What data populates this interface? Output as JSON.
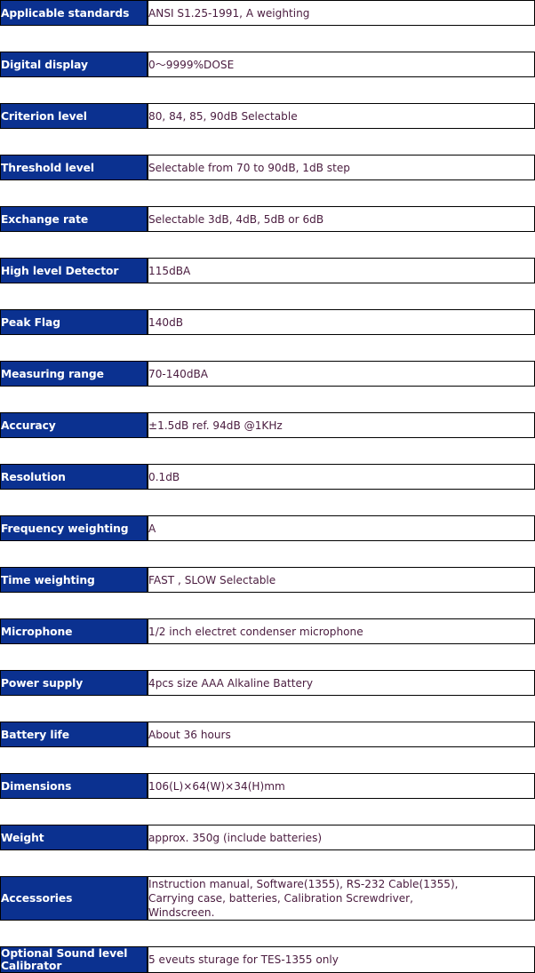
{
  "document": {
    "title": "Sound Level Meter Specifications",
    "colors": {
      "label_background": "#0b3190",
      "label_text": "#ffffff",
      "value_text": "#4a1c3f",
      "border": "#000000",
      "page_background": "#ffffff"
    }
  },
  "spec_table": {
    "rows": [
      {
        "label": "Applicable standards",
        "value": "ANSI S1.25-1991, A weighting"
      },
      {
        "label": "Digital display",
        "value": "0〜9999%DOSE"
      },
      {
        "label": "Criterion level",
        "value": "80, 84, 85, 90dB Selectable"
      },
      {
        "label": "Threshold level",
        "value": "Selectable from 70 to 90dB, 1dB step"
      },
      {
        "label": "Exchange rate",
        "value": "Selectable 3dB, 4dB, 5dB or 6dB"
      },
      {
        "label": "High level Detector",
        "value": "115dBA"
      },
      {
        "label": "Peak Flag",
        "value": "140dB"
      },
      {
        "label": "Measuring range",
        "value": "70-140dBA"
      },
      {
        "label": "Accuracy",
        "value": "±1.5dB ref. 94dB @1KHz"
      },
      {
        "label": "Resolution",
        "value": "0.1dB"
      },
      {
        "label": "Frequency weighting",
        "value": "A"
      },
      {
        "label": "Time weighting",
        "value": "FAST , SLOW Selectable"
      },
      {
        "label": "Microphone",
        "value": "1/2 inch electret condenser microphone"
      },
      {
        "label": "Power supply",
        "value": "4pcs size AAA Alkaline Battery"
      },
      {
        "label": "Battery life",
        "value": "About 36 hours"
      },
      {
        "label": "Dimensions",
        "value": "106(L)×64(W)×34(H)mm"
      },
      {
        "label": "Weight",
        "value": "approx. 350g (include batteries)"
      },
      {
        "label": "Accessories",
        "value": "Instruction manual, Software(1355), RS-232 Cable(1355),\nCarrying case, batteries, Calibration Screwdriver,\nWindscreen."
      },
      {
        "label": "Optional Sound level Calibrator",
        "value": "5 eveuts sturage for TES-1355 only"
      }
    ]
  }
}
